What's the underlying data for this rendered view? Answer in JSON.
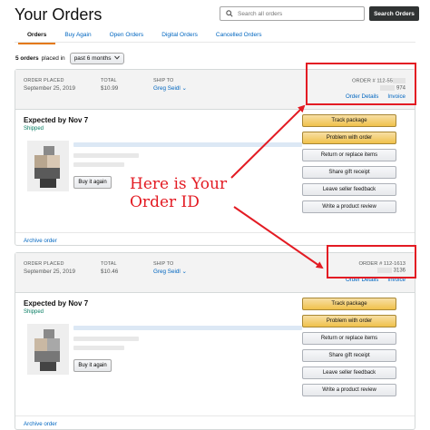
{
  "header": {
    "title": "Your Orders",
    "search_placeholder": "Search all orders",
    "search_button": "Search Orders"
  },
  "tabs": [
    {
      "label": "Orders",
      "active": true
    },
    {
      "label": "Buy Again"
    },
    {
      "label": "Open Orders"
    },
    {
      "label": "Digital Orders"
    },
    {
      "label": "Cancelled Orders"
    }
  ],
  "summary": {
    "count": "5 orders",
    "placed_in": "placed in",
    "filter": "past 6 months"
  },
  "orders": [
    {
      "placed_label": "ORDER PLACED",
      "placed_date": "September 25, 2019",
      "total_label": "TOTAL",
      "total": "$10.99",
      "ship_label": "SHIP TO",
      "ship_to": "Greg Seidl",
      "order_num": "ORDER # 112-55",
      "order_num_tail": "974",
      "order_details": "Order Details",
      "invoice": "Invoice",
      "expected": "Expected by Nov 7",
      "status": "Shipped",
      "buy_again": "Buy it again",
      "archive": "Archive order"
    },
    {
      "placed_label": "ORDER PLACED",
      "placed_date": "September 25, 2019",
      "total_label": "TOTAL",
      "total": "$10.46",
      "ship_label": "SHIP TO",
      "ship_to": "Greg Seidl",
      "order_num": "ORDER # 112-1613",
      "order_num_tail": "3136",
      "order_details": "Order Details",
      "invoice": "Invoice",
      "expected": "Expected by Nov 7",
      "status": "Shipped",
      "buy_again": "Buy it again",
      "archive": "Archive order"
    }
  ],
  "actions": [
    "Track package",
    "Problem with order",
    "Return or replace items",
    "Share gift receipt",
    "Leave seller feedback",
    "Write a product review"
  ],
  "annotation": {
    "line1": "Here is Your",
    "line2": "Order ID",
    "color": "#e31b23"
  },
  "colors": {
    "link": "#0066c0",
    "accent_tab": "#e47911",
    "primary_button": "#f0c14b",
    "shipped_status": "#067d62"
  }
}
